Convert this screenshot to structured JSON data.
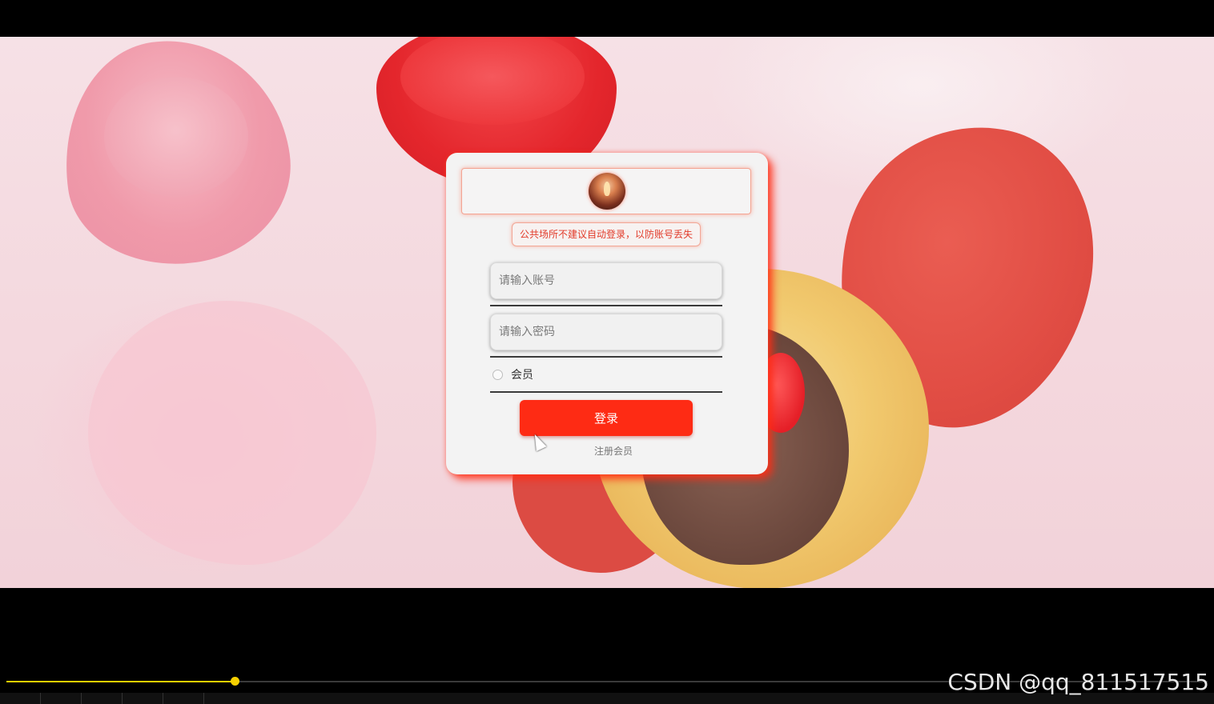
{
  "login": {
    "notice": "公共场所不建议自动登录，以防账号丢失",
    "username_placeholder": "请输入账号",
    "password_placeholder": "请输入密码",
    "member_label": "会员",
    "login_button": "登录",
    "register_link": "注册会员"
  },
  "player": {
    "progress": 0.19
  },
  "watermark": "CSDN @qq_811517515",
  "colors": {
    "accent": "#fe2b14",
    "notice_text": "#e23b2a",
    "progress": "#f5d000"
  }
}
